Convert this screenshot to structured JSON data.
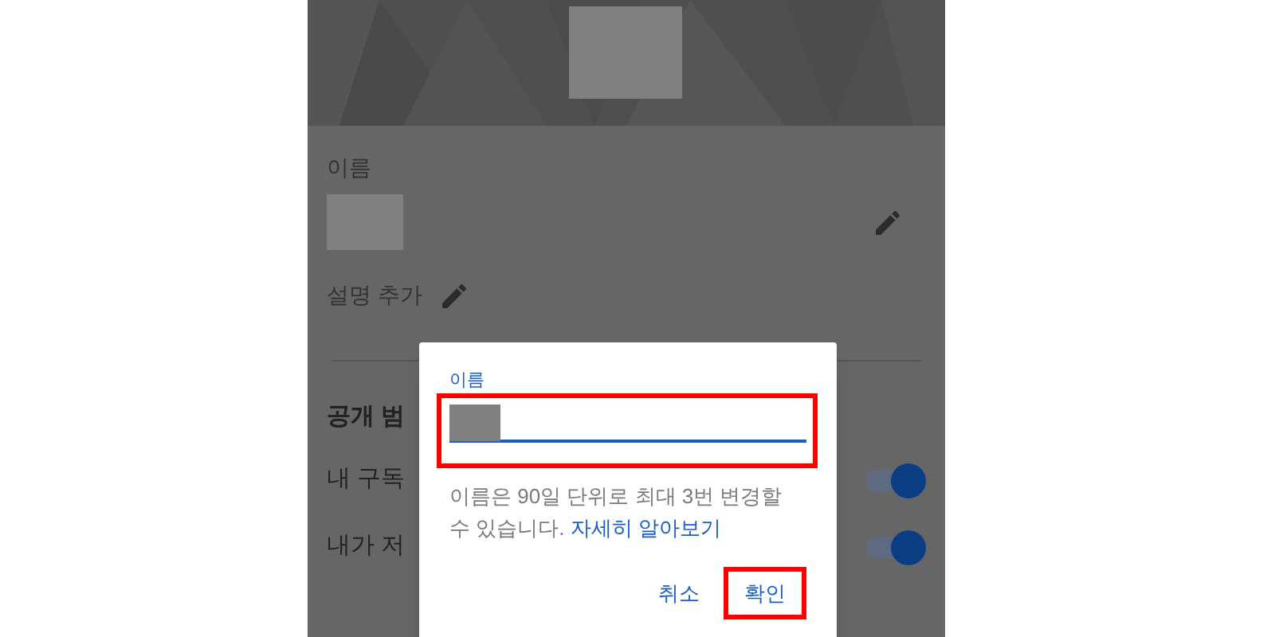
{
  "profile": {
    "name_label": "이름",
    "description_action": "설명 추가"
  },
  "privacy": {
    "heading": "공개 범",
    "settings": [
      {
        "label": "내 구독",
        "on": true
      },
      {
        "label": "내가 저",
        "on": true
      }
    ]
  },
  "dialog": {
    "field_label": "이름",
    "helper_text": "이름은 90일 단위로 최대 3번 변경할 수 있습니다.",
    "help_link": "자세히 알아보기",
    "buttons": [
      {
        "label": "취소",
        "highlighted": false
      },
      {
        "label": "확인",
        "highlighted": true
      }
    ],
    "field_highlighted": true
  }
}
